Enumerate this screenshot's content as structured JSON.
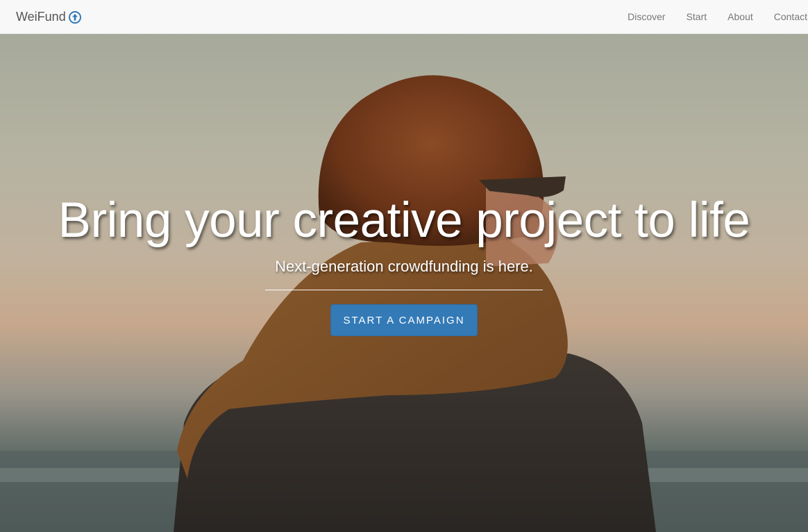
{
  "navbar": {
    "brand": "WeiFund",
    "brand_icon": "arrow-up-circle-icon",
    "links": [
      {
        "label": "Discover"
      },
      {
        "label": "Start"
      },
      {
        "label": "About"
      },
      {
        "label": "Contact"
      }
    ]
  },
  "hero": {
    "title": "Bring your creative project to life",
    "subtitle": "Next-generation crowdfunding is here.",
    "cta_label": "Start a campaign"
  },
  "colors": {
    "navbar_bg": "#f8f8f8",
    "nav_text": "#777777",
    "brand_icon": "#337ab7",
    "cta_bg": "#337ab7",
    "hero_text": "#ffffff"
  }
}
